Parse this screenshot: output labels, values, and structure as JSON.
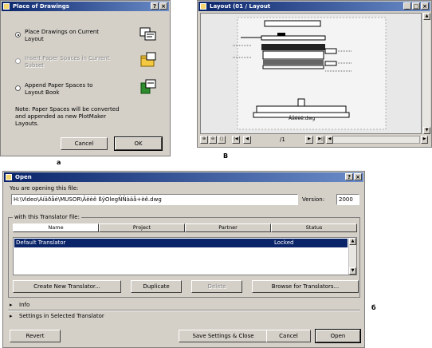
{
  "dialog_a": {
    "title": "Place of Drawings",
    "help_btn": "?",
    "close_btn": "×",
    "options": [
      {
        "label": "Place Drawings on Current Layout",
        "selected": true,
        "enabled": true
      },
      {
        "label": "Insert Paper Spaces in Current Subset",
        "selected": false,
        "enabled": false
      },
      {
        "label": "Append Paper Spaces to Layout Book",
        "selected": false,
        "enabled": true
      }
    ],
    "note": "Note: Paper Spaces will be converted and appended as new PlotMaker Layouts.",
    "cancel_label": "Cancel",
    "ok_label": "OK",
    "caption": "a"
  },
  "window_b": {
    "title": "Layout (01 / Layout",
    "min_btn": "_",
    "max_btn": "□",
    "close_btn": "×",
    "drawing_label": "Âåëèê.dwg",
    "page_indicator": "/1",
    "caption": "B"
  },
  "dialog_c": {
    "title": "Open",
    "help_btn": "?",
    "close_btn": "×",
    "opening_label": "You are opening this file:",
    "file_path": "H:\\Video\\Àíäðåé\\MUSOR\\Âëèê ßÿOlegÑÑàäå+èê.dwg",
    "version_label": "Version:",
    "version_value": "2000",
    "translator_group_label": "with this Translator file:",
    "columns": [
      "Name",
      "Project",
      "Partner",
      "Status"
    ],
    "rows": [
      {
        "name": "Default Translator",
        "project": "",
        "partner": "",
        "status": "Locked"
      }
    ],
    "buttons": {
      "create": "Create New Translator...",
      "duplicate": "Duplicate",
      "delete": "Delete",
      "browse": "Browse for Translators..."
    },
    "info_label": "Info",
    "settings_label": "Settings in Selected Translator",
    "revert_label": "Revert",
    "save_close_label": "Save Settings & Close",
    "cancel_label": "Cancel",
    "open_label": "Open",
    "caption": "б"
  }
}
